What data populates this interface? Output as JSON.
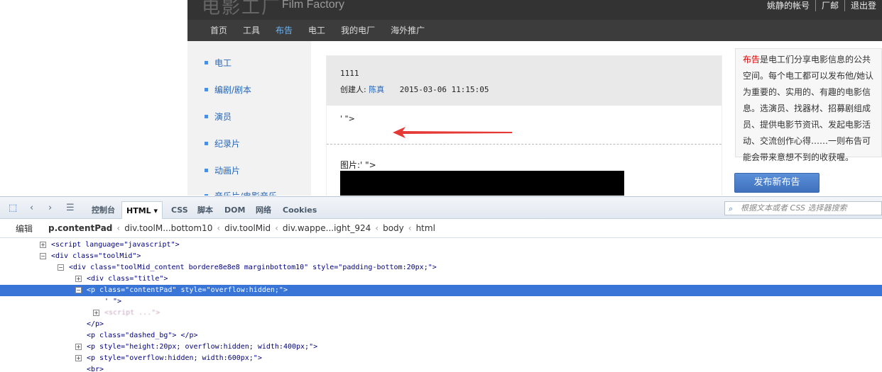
{
  "site": {
    "logo_cn": "电影工厂",
    "logo_en": "Film Factory",
    "header_links": [
      "姚静的帐号",
      "厂邮",
      "退出登"
    ],
    "nav": [
      "首页",
      "工具",
      "布告",
      "电工",
      "我的电厂",
      "海外推广"
    ],
    "nav_active_index": 2,
    "sidebar": [
      "电工",
      "编剧/剧本",
      "演员",
      "纪录片",
      "动画片",
      "音乐片/电影音乐"
    ],
    "post": {
      "title": "1111",
      "creator_label": "创建人:",
      "creator": "陈真",
      "date": "2015-03-06 11:15:05",
      "body_text": "' \">",
      "pic_label": "图片:' \">"
    },
    "notice": {
      "keyword": "布告",
      "text": "是电工们分享电影信息的公共空间。每个电工都可以发布他/她认为重要的、实用的、有趣的电影信息。选演员、找器材、招募剧组成员、提供电影节资讯、发起电影活动、交流创作心得……一则布告可能会带来意想不到的收获喔。"
    },
    "post_button": "发布新布告"
  },
  "devtools": {
    "tabs": [
      "控制台",
      "HTML ▾",
      "CSS",
      "脚本",
      "DOM",
      "网络",
      "Cookies"
    ],
    "active_tab_index": 1,
    "search_placeholder": "根据文本或者 CSS 选择器搜索",
    "edit_label": "编辑",
    "breadcrumbs": [
      "p.contentPad",
      "div.toolM...bottom10",
      "div.toolMid",
      "div.wappe...ight_924",
      "body",
      "html"
    ],
    "tree": [
      {
        "toggle": "+",
        "indent": 0,
        "text": "<script language=\"javascript\">"
      },
      {
        "toggle": "-",
        "indent": 0,
        "text": "<div class=\"toolMid\">"
      },
      {
        "toggle": "-",
        "indent": 1,
        "text": "<div class=\"toolMid_content bordere8e8e8 marginbottom10\" style=\"padding-bottom:20px;\">"
      },
      {
        "toggle": "+",
        "indent": 2,
        "text": "<div class=\"title\">"
      },
      {
        "toggle": "-",
        "indent": 2,
        "text": "<p class=\"contentPad\" style=\"overflow:hidden;\">",
        "selected": true
      },
      {
        "toggle": "",
        "indent": 3,
        "text": "' \">"
      },
      {
        "toggle": "+",
        "indent": 3,
        "text": "<script ...\">",
        "blurred": true
      },
      {
        "toggle": "",
        "indent": 2,
        "text": "</p>"
      },
      {
        "toggle": "",
        "indent": 2,
        "text": "<p class=\"dashed_bg\"> </p>"
      },
      {
        "toggle": "+",
        "indent": 2,
        "text": "<p style=\"height:20px; overflow:hidden; width:400px;\">"
      },
      {
        "toggle": "+",
        "indent": 2,
        "text": "<p style=\"overflow:hidden; width:600px;\">"
      },
      {
        "toggle": "",
        "indent": 2,
        "text": "<br>"
      }
    ]
  },
  "colors": {
    "selection": "#3875d7",
    "arrow": "#e53935",
    "link": "#2a66b5",
    "accent_red": "#d00000"
  }
}
